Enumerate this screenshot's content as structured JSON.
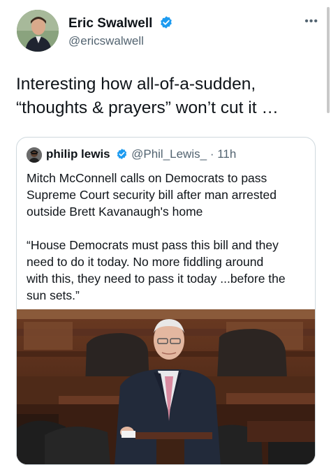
{
  "tweet": {
    "author": {
      "name": "Eric Swalwell",
      "handle": "@ericswalwell",
      "verified": true
    },
    "more_icon": "more-horizontal-icon",
    "text_line1": "Interesting how all-of-a-sudden,",
    "text_line2": "“thoughts & prayers” won’t cut it …"
  },
  "quoted_tweet": {
    "author": {
      "name": "philip lewis",
      "handle": "@Phil_Lewis_",
      "verified": true
    },
    "time": "· 11h",
    "headline_lines": [
      "Mitch McConnell calls on Democrats to pass",
      "Supreme Court security bill after man arrested",
      "outside Brett Kavanaugh's home"
    ],
    "quote_lines": [
      "“House Democrats must pass this bill  and they",
      "need to do it today. No more fiddling around",
      "with this, they need to pass it today ...before the",
      "sun sets.”"
    ]
  },
  "colors": {
    "verified_blue": "#1d9bf0",
    "secondary_text": "#536471",
    "border": "#cfd9de"
  }
}
